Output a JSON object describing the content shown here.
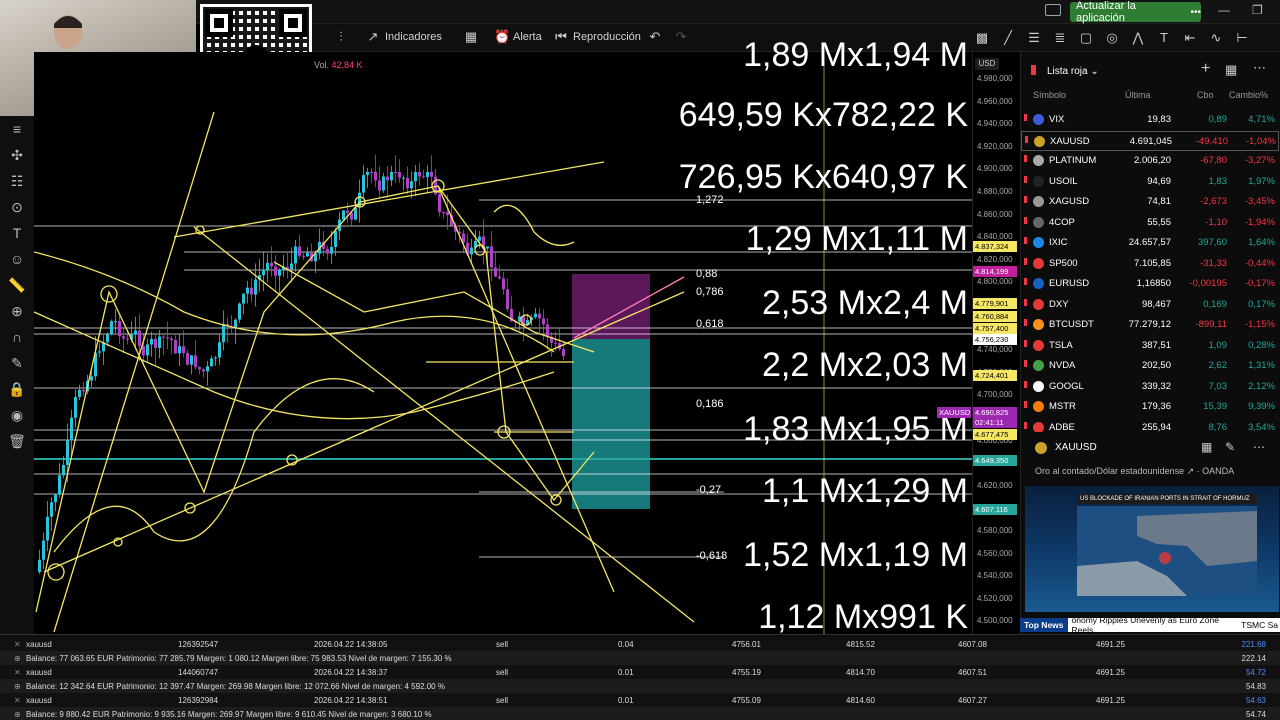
{
  "topbar": {
    "update_label": "Actualizar la aplicación",
    "update_dots": "•••",
    "min": "—",
    "max": "❐"
  },
  "toolbar": {
    "indicators": "Indicadores",
    "alert": "Alerta",
    "replay": "Reproducción"
  },
  "chart": {
    "volume_label": "Vol.",
    "volume_value": "42,84 K",
    "currency": "USD",
    "price_ticks": [
      "4.980,000",
      "4.960,000",
      "4.940,000",
      "4.920,000",
      "4.900,000",
      "4.880,000",
      "4.860,000",
      "4.840,000",
      "4.820,000",
      "4.800,000",
      "4.780,000",
      "4.760,000",
      "4.740,000",
      "4.720,000",
      "4.700,000",
      "4.680,000",
      "4.660,000",
      "4.640,000",
      "4.620,000",
      "4.600,000",
      "4.580,000",
      "4.560,000",
      "4.540,000",
      "4.520,000",
      "4.500,000"
    ],
    "price_labels": [
      {
        "text": "4.837,324",
        "color": "#f5e663"
      },
      {
        "text": "4.814,199",
        "color": "#c21f9c"
      },
      {
        "text": "4.779,901",
        "color": "#f5e663"
      },
      {
        "text": "4.760,884",
        "color": "#f5e663"
      },
      {
        "text": "4.757,400",
        "color": "#f5e663"
      },
      {
        "text": "4.756,230",
        "color": "#ffffff"
      },
      {
        "text": "4.724,401",
        "color": "#f5e663"
      },
      {
        "text": "XAUUSD",
        "color": "#9c27b0"
      },
      {
        "text": "4.690,825",
        "color": "#9c27b0"
      },
      {
        "text": "02:41:11",
        "color": "#9c27b0"
      },
      {
        "text": "4.677,475",
        "color": "#f5e663"
      },
      {
        "text": "4.649,350",
        "color": "#26a69a"
      },
      {
        "text": "4.607,116",
        "color": "#26a69a"
      }
    ],
    "big_numbers": [
      "1,89 Mx1,94 M",
      "649,59 Kx782,22 K",
      "726,95 Kx640,97 K",
      "1,29 Mx1,11 M",
      "2,53 Mx2,4 M",
      "2,2 Mx2,03 M",
      "1,83 Mx1,95 M",
      "1,1 Mx1,29 M",
      "1,52 Mx1,19 M",
      "1,12 Mx991 K"
    ],
    "fib_levels": [
      "1,272",
      "0,88",
      "0,786",
      "0,618",
      "0,186",
      "-0,27",
      "-0,618"
    ]
  },
  "watchlist": {
    "title": "Lista roja",
    "columns": [
      "Símbolo",
      "Última",
      "Cbo",
      "Cambio%"
    ],
    "rows": [
      {
        "symbol": "VIX",
        "last": "19,83",
        "chg": "0,89",
        "pct": "4,71%",
        "dir": "up",
        "icon": "#3b5bdb"
      },
      {
        "symbol": "XAUUSD",
        "last": "4.691,045",
        "chg": "-49,410",
        "pct": "-1,04%",
        "dir": "dn",
        "icon": "#c9a227"
      },
      {
        "symbol": "PLATINUM",
        "last": "2.006,20",
        "chg": "-67,80",
        "pct": "-3,27%",
        "dir": "dn",
        "icon": "#aaaaaa"
      },
      {
        "symbol": "USOIL",
        "last": "94,69",
        "chg": "1,83",
        "pct": "1,97%",
        "dir": "up",
        "icon": "#222222"
      },
      {
        "symbol": "XAGUSD",
        "last": "74,81",
        "chg": "-2,673",
        "pct": "-3,45%",
        "dir": "dn",
        "icon": "#999999"
      },
      {
        "symbol": "4COP",
        "last": "55,55",
        "chg": "-1,10",
        "pct": "-1,94%",
        "dir": "dn",
        "icon": "#666666"
      },
      {
        "symbol": "IXIC",
        "last": "24.657,57",
        "chg": "397,60",
        "pct": "1,64%",
        "dir": "up",
        "icon": "#1e88e5"
      },
      {
        "symbol": "SP500",
        "last": "7.105,85",
        "chg": "-31,33",
        "pct": "-0,44%",
        "dir": "dn",
        "icon": "#e53935"
      },
      {
        "symbol": "EURUSD",
        "last": "1,16850",
        "chg": "-0,00195",
        "pct": "-0,17%",
        "dir": "dn",
        "icon": "#1565c0"
      },
      {
        "symbol": "DXY",
        "last": "98,467",
        "chg": "0,169",
        "pct": "0,17%",
        "dir": "up",
        "icon": "#e53935"
      },
      {
        "symbol": "BTCUSDT",
        "last": "77.279,12",
        "chg": "-899,11",
        "pct": "-1,15%",
        "dir": "dn",
        "icon": "#f7931a"
      },
      {
        "symbol": "TSLA",
        "last": "387,51",
        "chg": "1,09",
        "pct": "0,28%",
        "dir": "up",
        "icon": "#e53935"
      },
      {
        "symbol": "NVDA",
        "last": "202,50",
        "chg": "2,62",
        "pct": "1,31%",
        "dir": "up",
        "icon": "#43a047"
      },
      {
        "symbol": "GOOGL",
        "last": "339,32",
        "chg": "7,03",
        "pct": "2,12%",
        "dir": "up",
        "icon": "#ffffff"
      },
      {
        "symbol": "MSTR",
        "last": "179,36",
        "chg": "15,39",
        "pct": "9,39%",
        "dir": "up",
        "icon": "#f57c00"
      },
      {
        "symbol": "ADBE",
        "last": "255,94",
        "chg": "8,76",
        "pct": "3,54%",
        "dir": "up",
        "icon": "#e53935"
      }
    ]
  },
  "detail": {
    "symbol": "XAUUSD",
    "subtitle": "Oro al contado/Dólar estadounidense",
    "exchange": "OANDA",
    "news_headline": "US BLOCKADE OF IRANIAN PORTS IN STRAIT OF HORMUZ",
    "ticker_label": "Top News",
    "ticker_text": "onomy Ripples Unevenly as Euro Zone Reels",
    "ticker_text2": "TSMC Sa"
  },
  "bottom": {
    "positions": [
      {
        "sym": "xauusd",
        "id": "126392547",
        "time": "2026.04.22 14:38:05",
        "type": "sell",
        "vol": "0.04",
        "open": "4756.01",
        "sl": "4815.52",
        "tp": "4607.08",
        "price": "4691.25",
        "profit": "221.68"
      },
      {
        "sym": "xauusd",
        "id": "144060747",
        "time": "2026.04.22 14:38:37",
        "type": "sell",
        "vol": "0.01",
        "open": "4755.19",
        "sl": "4814.70",
        "tp": "4607.51",
        "price": "4691.25",
        "profit": "54.72"
      },
      {
        "sym": "xauusd",
        "id": "126392984",
        "time": "2026.04.22 14:38:51",
        "type": "sell",
        "vol": "0.01",
        "open": "4755.09",
        "sl": "4814.60",
        "tp": "4607.27",
        "price": "4691.25",
        "profit": "54.63"
      }
    ],
    "balances": [
      {
        "text": "Balance: 77 063.65 EUR  Patrimonio: 77 285.79  Margen: 1 080.12  Margen libre: 75 983.53  Nivel de margen: 7 155.30 %",
        "total": "222.14"
      },
      {
        "text": "Balance: 12 342.64 EUR  Patrimonio: 12 397.47  Margen: 269.98  Margen libre: 12 072.66  Nivel de margen: 4 592.00 %",
        "total": "54.83"
      },
      {
        "text": "Balance: 9 880.42 EUR  Patrimonio: 9 935.16  Margen: 269.97  Margen libre: 9 610.45  Nivel de margen: 3 680.10 %",
        "total": "54.74"
      }
    ]
  }
}
